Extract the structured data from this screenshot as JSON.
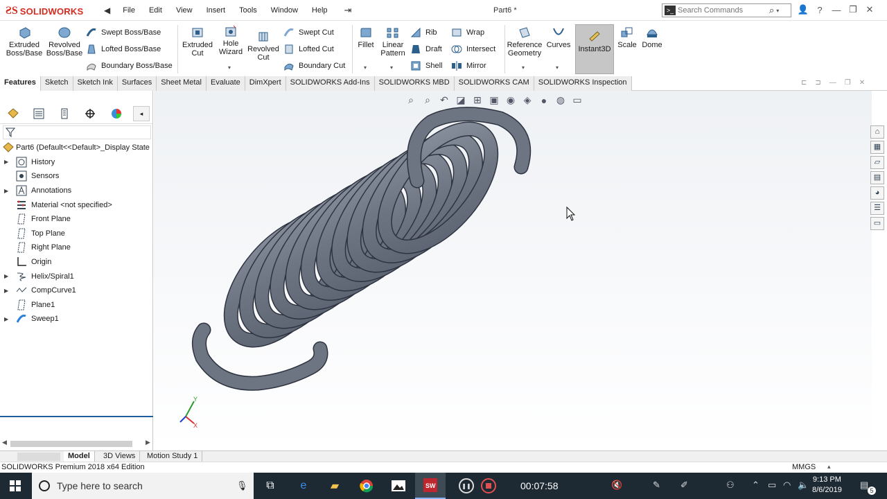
{
  "app": {
    "logo_text": "SOLIDWORKS",
    "document_title": "Part6 *",
    "menus": [
      "File",
      "Edit",
      "View",
      "Insert",
      "Tools",
      "Window",
      "Help"
    ],
    "search_placeholder": "Search Commands"
  },
  "command_manager": {
    "extruded_boss": "Extruded Boss/Base",
    "revolved_boss": "Revolved Boss/Base",
    "swept_boss": "Swept Boss/Base",
    "lofted_boss": "Lofted Boss/Base",
    "boundary_boss": "Boundary Boss/Base",
    "extruded_cut": "Extruded Cut",
    "hole_wizard": "Hole Wizard",
    "revolved_cut": "Revolved Cut",
    "swept_cut": "Swept Cut",
    "lofted_cut": "Lofted Cut",
    "boundary_cut": "Boundary Cut",
    "fillet": "Fillet",
    "linear_pattern": "Linear Pattern",
    "rib": "Rib",
    "draft": "Draft",
    "shell": "Shell",
    "wrap": "Wrap",
    "intersect": "Intersect",
    "mirror": "Mirror",
    "reference_geometry": "Reference Geometry",
    "curves": "Curves",
    "instant3d": "Instant3D",
    "scale": "Scale",
    "dome": "Dome"
  },
  "tabs": [
    "Features",
    "Sketch",
    "Sketch Ink",
    "Surfaces",
    "Sheet Metal",
    "Evaluate",
    "DimXpert",
    "SOLIDWORKS Add-Ins",
    "SOLIDWORKS MBD",
    "SOLIDWORKS CAM",
    "SOLIDWORKS Inspection"
  ],
  "tree": {
    "root": "Part6  (Default<<Default>_Display State",
    "items": [
      {
        "label": "History",
        "expandable": true
      },
      {
        "label": "Sensors",
        "expandable": false
      },
      {
        "label": "Annotations",
        "expandable": true
      },
      {
        "label": "Material <not specified>",
        "expandable": false
      },
      {
        "label": "Front Plane",
        "expandable": false
      },
      {
        "label": "Top Plane",
        "expandable": false
      },
      {
        "label": "Right Plane",
        "expandable": false
      },
      {
        "label": "Origin",
        "expandable": false
      },
      {
        "label": "Helix/Spiral1",
        "expandable": true
      },
      {
        "label": "CompCurve1",
        "expandable": true
      },
      {
        "label": "Plane1",
        "expandable": false
      },
      {
        "label": "Sweep1",
        "expandable": true
      }
    ]
  },
  "bottom_tabs": [
    "Model",
    "3D Views",
    "Motion Study 1"
  ],
  "status": {
    "edition": "SOLIDWORKS Premium 2018 x64 Edition",
    "units": "MMGS"
  },
  "taskbar": {
    "search_placeholder": "Type here to search",
    "timer": "00:07:58",
    "time": "9:13 PM",
    "date": "8/6/2019",
    "notifications": "5"
  },
  "triad": {
    "x_label": "X",
    "y_label": "Y"
  },
  "colors": {
    "brand_red": "#d52b1e",
    "spring_gray": "#6e7582",
    "tab_active": "#ffffff",
    "taskbar": "#1e2a33"
  }
}
